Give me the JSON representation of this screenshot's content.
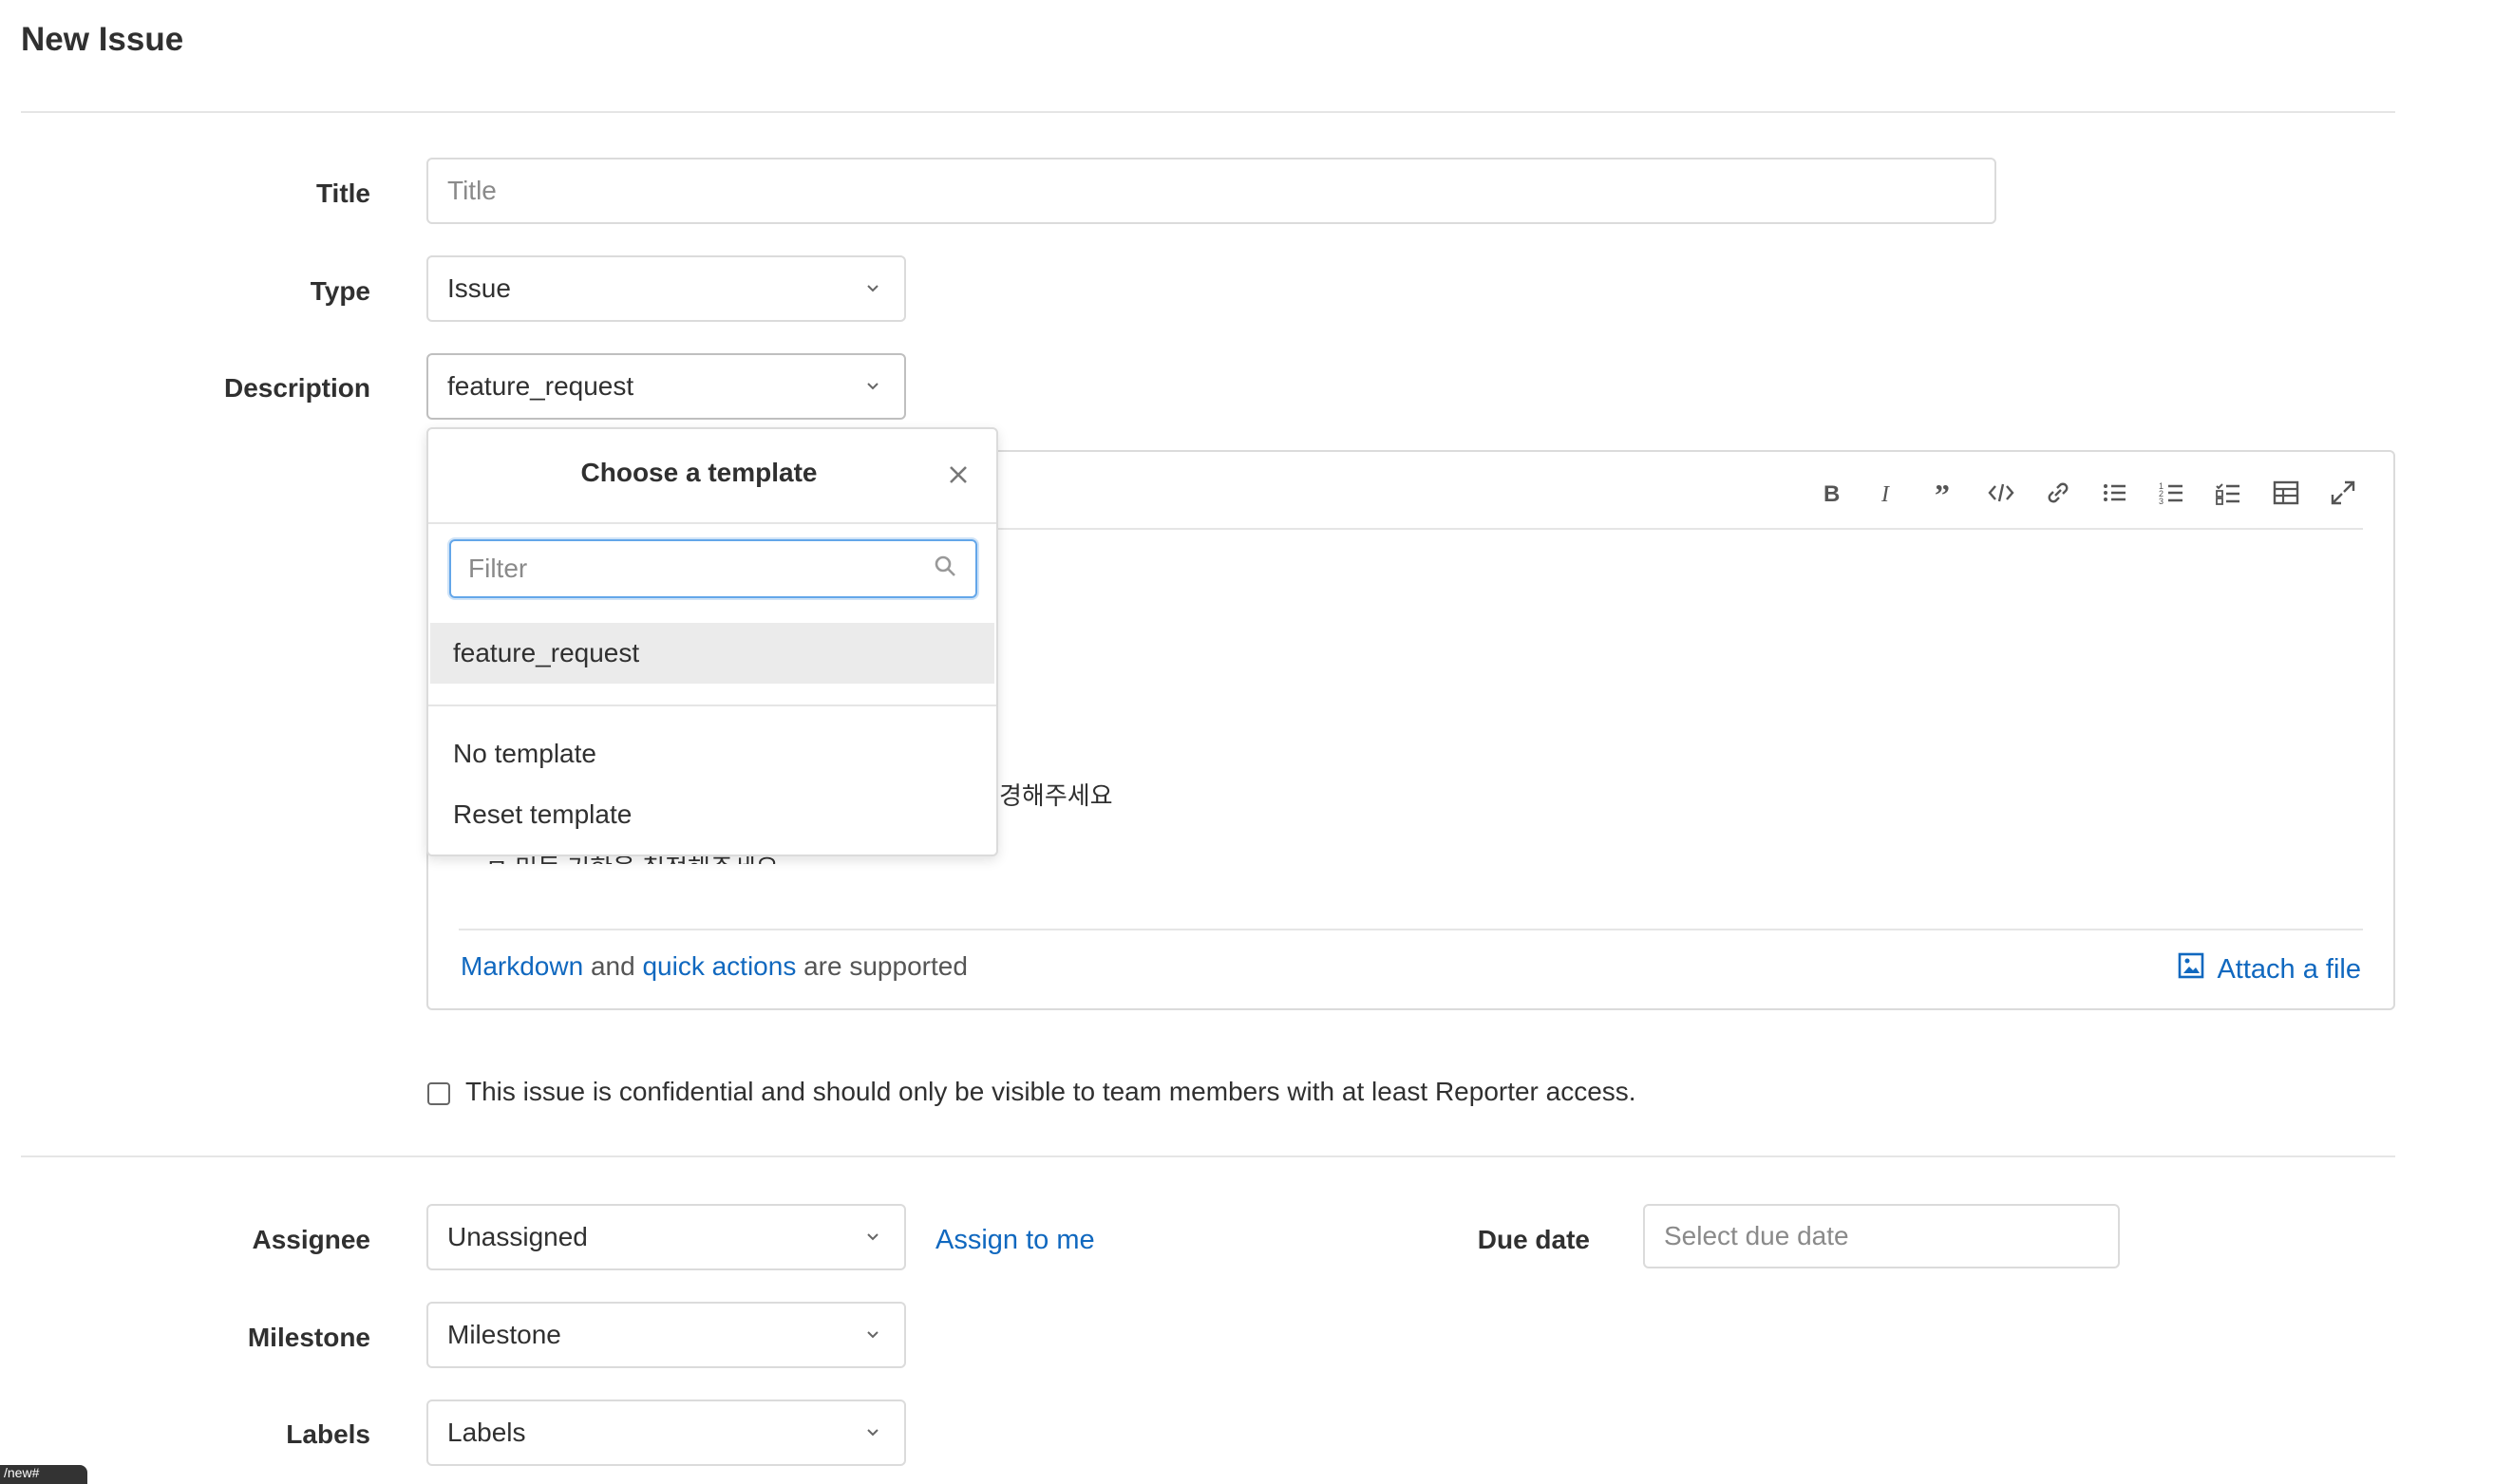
{
  "page": {
    "title": "New Issue"
  },
  "form": {
    "title": {
      "label": "Title",
      "placeholder": "Title"
    },
    "type": {
      "label": "Type",
      "value": "Issue"
    },
    "description": {
      "label": "Description",
      "template_value": "feature_request",
      "toolbar": [
        "bold-icon",
        "italic-icon",
        "quote-icon",
        "code-icon",
        "link-icon",
        "bullet-list-icon",
        "numbered-list-icon",
        "task-list-icon",
        "table-icon",
        "fullscreen-icon"
      ],
      "editor_visible_text": [
        "경해주세요",
        "ㅁ  미듬  기한을  칠정해주세요"
      ],
      "hint": {
        "markdown": "Markdown",
        "and": "and",
        "quick_actions": "quick actions",
        "supported": "are supported"
      },
      "attach_label": "Attach a file"
    },
    "confidential": {
      "checked": false,
      "label": "This issue is confidential and should only be visible to team members with at least Reporter access."
    },
    "assignee": {
      "label": "Assignee",
      "value": "Unassigned",
      "assign_to_me": "Assign to me"
    },
    "due_date": {
      "label": "Due date",
      "placeholder": "Select due date"
    },
    "milestone": {
      "label": "Milestone",
      "value": "Milestone"
    },
    "labels": {
      "label": "Labels",
      "value": "Labels"
    }
  },
  "template_dropdown": {
    "title": "Choose a template",
    "filter_placeholder": "Filter",
    "items": [
      {
        "label": "feature_request",
        "active": true
      }
    ],
    "actions": [
      {
        "label": "No template"
      },
      {
        "label": "Reset template"
      }
    ]
  },
  "colors": {
    "link": "#1068bf",
    "border": "#dbdbdb",
    "focus": "#63a6e9"
  },
  "tooltip": {
    "text": "/new#"
  }
}
